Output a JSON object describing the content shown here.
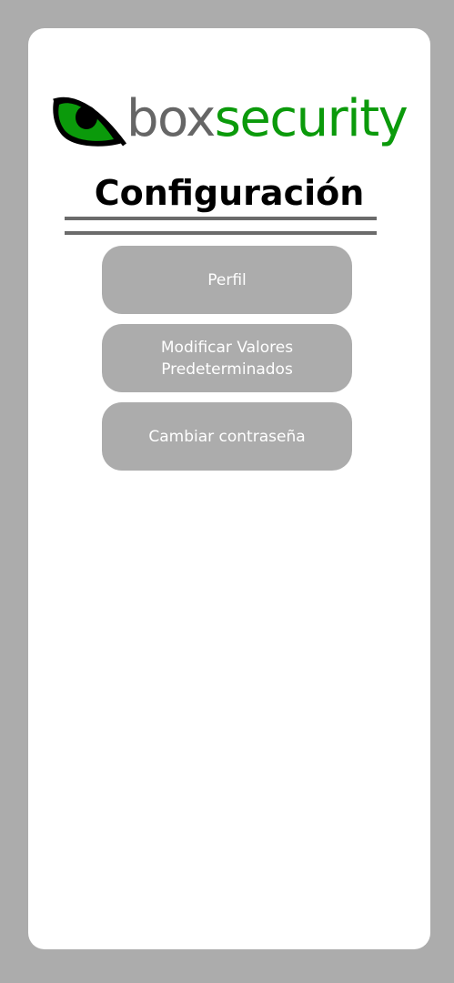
{
  "brand": {
    "part1": "box",
    "part2": "security",
    "colors": {
      "gray": "#666666",
      "green": "#0b9a0b"
    },
    "icon": "eye-logo-icon"
  },
  "page": {
    "title": "Configuración"
  },
  "menu": {
    "items": [
      {
        "label": "Perfil"
      },
      {
        "label": "Modificar Valores Predeterminados"
      },
      {
        "label": "Cambiar contraseña"
      }
    ]
  },
  "colors": {
    "background": "#acacac",
    "card": "#ffffff",
    "button": "#acacac",
    "button_text": "#ffffff",
    "rule": "#6b6b6b"
  }
}
